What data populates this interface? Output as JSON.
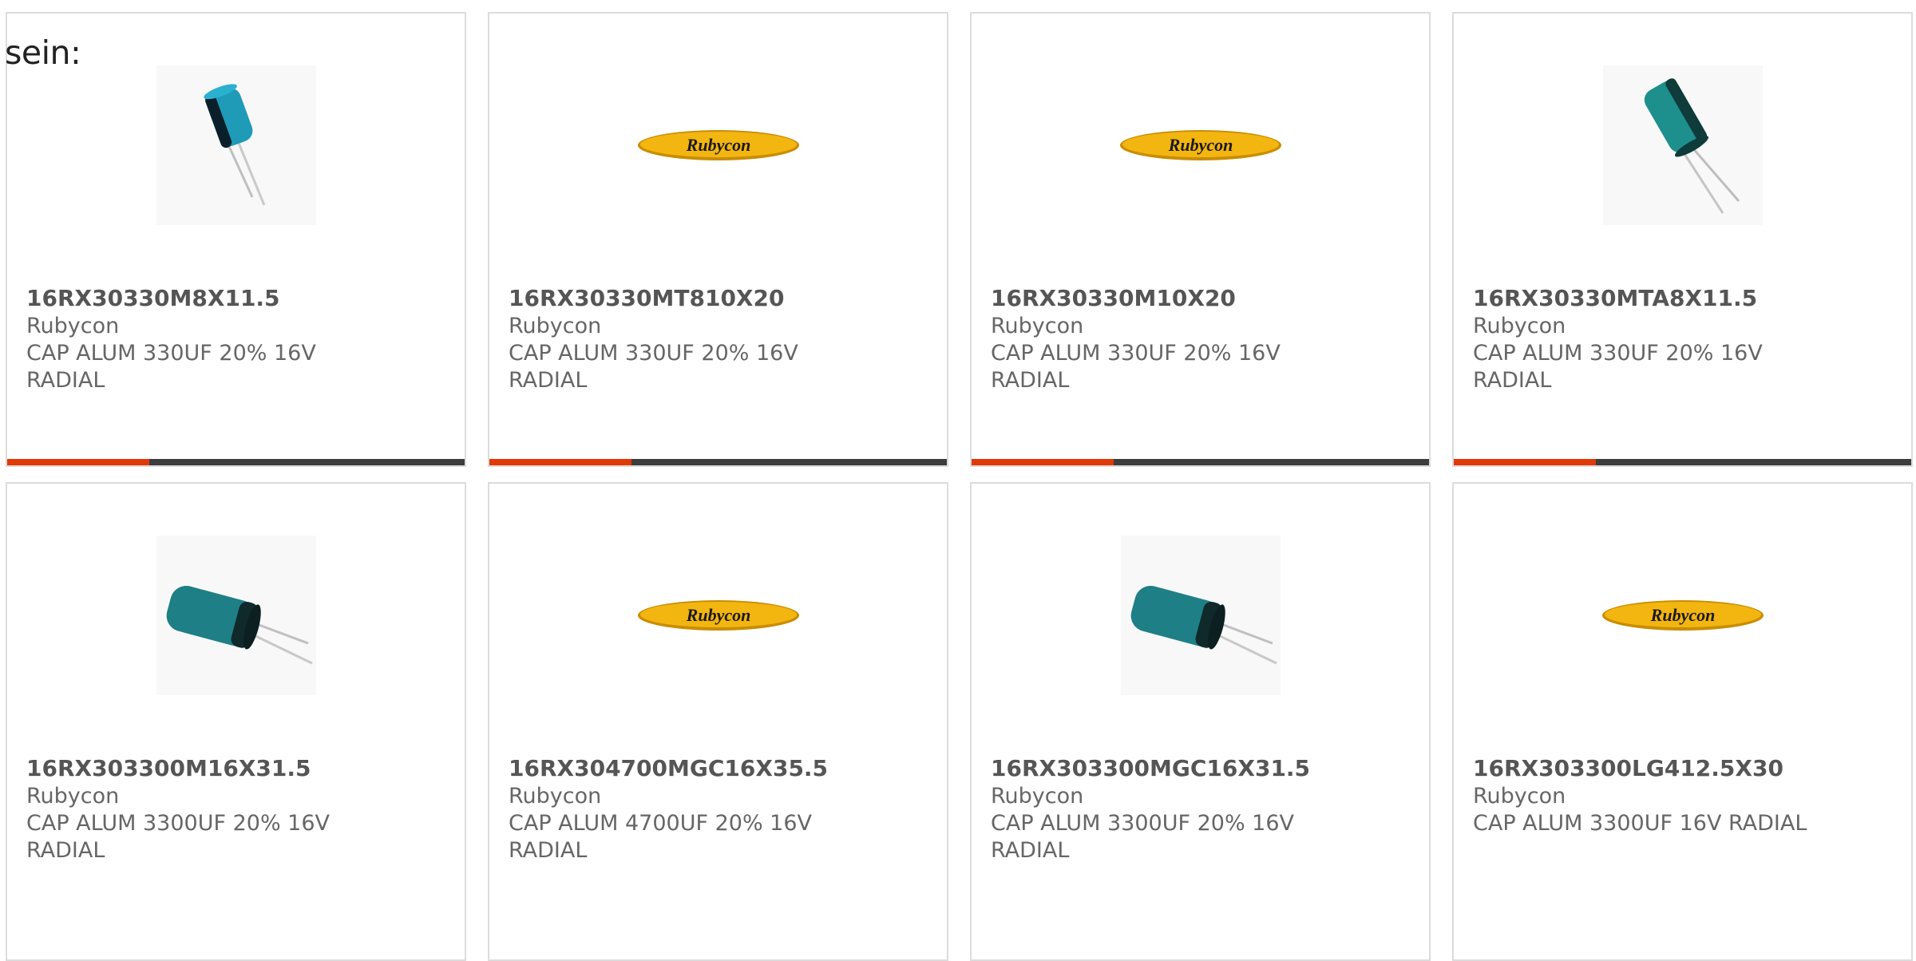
{
  "intro_text": "sein:",
  "accent_color": "#e03a08",
  "bar_color": "#3d3d3d",
  "progress_fraction": 0.31,
  "products": [
    {
      "part": "16RX30330M8X11.5",
      "manufacturer": "Rubycon",
      "description": "CAP ALUM 330UF 20% 16V RADIAL",
      "image": "capacitor-small-icon"
    },
    {
      "part": "16RX30330MT810X20",
      "manufacturer": "Rubycon",
      "description": "CAP ALUM 330UF 20% 16V RADIAL",
      "image": "rubycon-logo",
      "logo_text": "Rubycon"
    },
    {
      "part": "16RX30330M10X20",
      "manufacturer": "Rubycon",
      "description": "CAP ALUM 330UF 20% 16V RADIAL",
      "image": "rubycon-logo",
      "logo_text": "Rubycon"
    },
    {
      "part": "16RX30330MTA8X11.5",
      "manufacturer": "Rubycon",
      "description": "CAP ALUM 330UF 20% 16V RADIAL",
      "image": "capacitor-green-icon"
    },
    {
      "part": "16RX303300M16X31.5",
      "manufacturer": "Rubycon",
      "description": "CAP ALUM 3300UF 20% 16V RADIAL",
      "image": "capacitor-large-icon"
    },
    {
      "part": "16RX304700MGC16X35.5",
      "manufacturer": "Rubycon",
      "description": "CAP ALUM 4700UF 20% 16V RADIAL",
      "image": "rubycon-logo",
      "logo_text": "Rubycon"
    },
    {
      "part": "16RX303300MGC16X31.5",
      "manufacturer": "Rubycon",
      "description": "CAP ALUM 3300UF 20% 16V RADIAL",
      "image": "capacitor-large-icon"
    },
    {
      "part": "16RX303300LG412.5X30",
      "manufacturer": "Rubycon",
      "description": "CAP ALUM 3300UF 16V RADIAL",
      "image": "rubycon-logo",
      "logo_text": "Rubycon"
    }
  ]
}
